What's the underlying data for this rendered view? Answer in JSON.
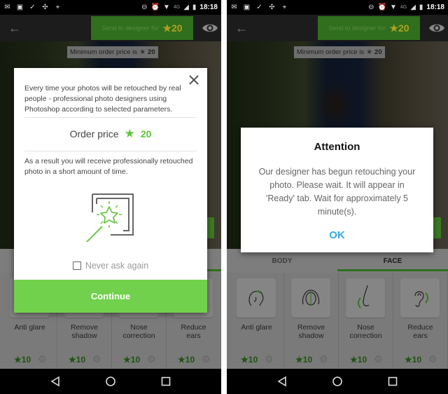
{
  "status_bar": {
    "left_icons": [
      "gmail-icon",
      "image-icon",
      "download-done-icon",
      "pinwheel-icon",
      "maps-icon"
    ],
    "right_icons": [
      "do-not-disturb-icon",
      "alarm-icon",
      "wifi-icon",
      "network-4g-icon",
      "signal-icon",
      "battery-icon"
    ],
    "network": "4G",
    "time": "18:18"
  },
  "toolbar": {
    "send_label": "Send to designer for",
    "send_price": "20",
    "accent_color": "#2f6f1d"
  },
  "photo_overlay": {
    "min_price_label": "Minimum order price is",
    "min_price_value": "20"
  },
  "tabs": [
    {
      "label": "BODY",
      "active": false
    },
    {
      "label": "FACE",
      "active": true
    }
  ],
  "cards": [
    {
      "name_line1": "Anti glare",
      "name_line2": "",
      "price": "10",
      "icon": "head-glare-icon"
    },
    {
      "name_line1": "Remove",
      "name_line2": "shadow",
      "price": "10",
      "icon": "face-shadow-icon"
    },
    {
      "name_line1": "Nose",
      "name_line2": "correction",
      "price": "10",
      "icon": "nose-icon"
    },
    {
      "name_line1": "Reduce",
      "name_line2": "ears",
      "price": "10",
      "icon": "ear-icon"
    }
  ],
  "dialog_info": {
    "paragraph1": "Every time your photos will be retouched by real people - professional photo designers using Photoshop according to selected parameters.",
    "order_price_label": "Order price",
    "order_price_value": "20",
    "paragraph2": "As a result you will receive professionally retouched photo in a short amount of time.",
    "never_ask_label": "Never ask again",
    "never_ask_checked": false,
    "continue_label": "Continue",
    "accent_color": "#72d14c"
  },
  "dialog_attention": {
    "title": "Attention",
    "body": "Our designer has begun retouching your photo. Please wait. It will appear in 'Ready' tab. Wait for approximately 5 minute(s).",
    "ok_label": "OK",
    "ok_color": "#35aadc"
  }
}
